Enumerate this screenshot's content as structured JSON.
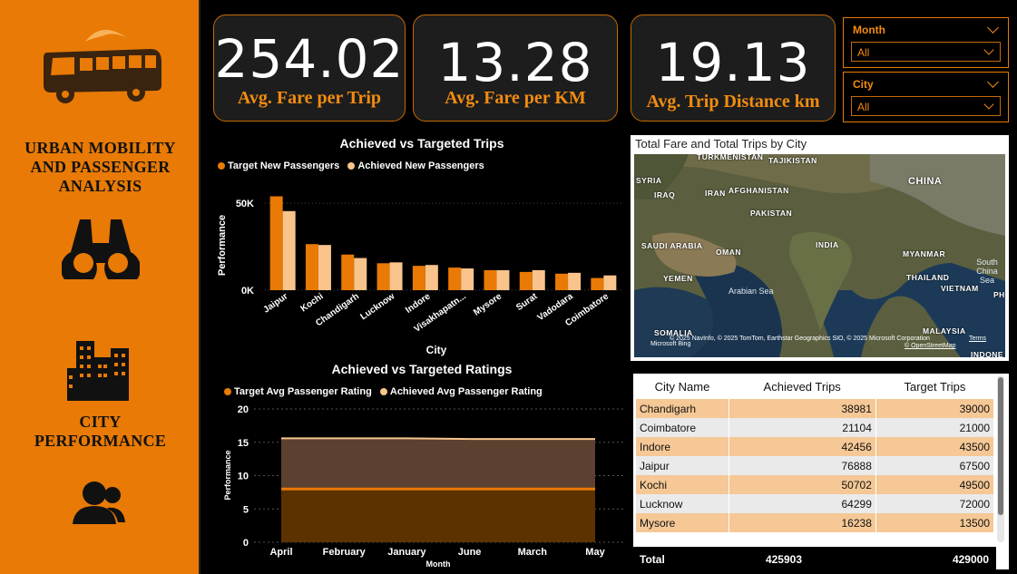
{
  "sidebar": {
    "title_line1": "URBAN MOBILITY",
    "title_line2": "AND PASSENGER",
    "title_line3": "ANALYSIS",
    "section_line1": "CITY",
    "section_line2": "PERFORMANCE",
    "icons": [
      "bus-icon",
      "binoculars-icon",
      "buildings-icon",
      "users-icon"
    ]
  },
  "kpis": [
    {
      "value": "254.02",
      "label": "Avg. Fare per Trip"
    },
    {
      "value": "13.28",
      "label": "Avg. Fare per KM"
    },
    {
      "value": "19.13",
      "label": "Avg. Trip Distance km"
    }
  ],
  "slicers": [
    {
      "title": "Month",
      "value": "All"
    },
    {
      "title": "City",
      "value": "All"
    }
  ],
  "colors": {
    "accent": "#e87a05",
    "light": "#f8c48c",
    "dark_fill": "#5c3200"
  },
  "trips_chart": {
    "title": "Achieved vs Targeted Trips",
    "legend": [
      "Target New Passengers",
      "Achieved New Passengers"
    ],
    "ylabel": "Performance",
    "xlabel": "City",
    "yticks": [
      "50K",
      "0K"
    ]
  },
  "ratings_chart": {
    "title": "Achieved vs Targeted Ratings",
    "legend": [
      "Target Avg Passenger Rating",
      "Achieved Avg Passenger Rating"
    ],
    "ylabel": "Performance",
    "xlabel": "Month",
    "yticks": [
      "20",
      "15",
      "10",
      "5",
      "0"
    ]
  },
  "chart_data": [
    {
      "type": "bar",
      "title": "Achieved vs Targeted Trips",
      "xlabel": "City",
      "ylabel": "Performance",
      "categories": [
        "Jaipur",
        "Kochi",
        "Chandigarh",
        "Lucknow",
        "Indore",
        "Visakhapatn...",
        "Mysore",
        "Surat",
        "Vadodara",
        "Coimbatore"
      ],
      "series": [
        {
          "name": "Target New Passengers",
          "values": [
            54000,
            26500,
            20500,
            15500,
            14000,
            13000,
            11500,
            10500,
            9500,
            7000
          ]
        },
        {
          "name": "Achieved New Passengers",
          "values": [
            45500,
            26000,
            18500,
            16000,
            14500,
            12500,
            11500,
            11500,
            10000,
            8500
          ]
        }
      ],
      "ylim": [
        0,
        60000
      ],
      "legend": "top"
    },
    {
      "type": "area",
      "title": "Achieved vs Targeted Ratings",
      "xlabel": "Month",
      "ylabel": "Performance",
      "categories": [
        "April",
        "February",
        "January",
        "June",
        "March",
        "May"
      ],
      "series": [
        {
          "name": "Target Avg Passenger Rating",
          "values": [
            8.0,
            8.0,
            8.0,
            8.0,
            8.0,
            8.0
          ]
        },
        {
          "name": "Achieved Avg Passenger Rating",
          "values": [
            15.6,
            15.6,
            15.6,
            15.5,
            15.5,
            15.5
          ]
        }
      ],
      "ylim": [
        0,
        20
      ],
      "legend": "top"
    }
  ],
  "map": {
    "title": "Total Fare and Total Trips by City",
    "labels": [
      "TURKMENISTAN",
      "TAJIKISTAN",
      "SYRIA",
      "IRAQ",
      "IRAN",
      "AFGHANISTAN",
      "CHINA",
      "PAKISTAN",
      "SAUDI ARABIA",
      "OMAN",
      "INDIA",
      "MYANMAR",
      "YEMEN",
      "THAILAND",
      "VIETNAM",
      "South China Sea",
      "PH",
      "Arabian Sea",
      "SOMALIA",
      "MALAYSIA",
      "INDONE"
    ],
    "copyright": "© 2025 NavInfo, © 2025 TomTom, Earthstar Geographics SIO, © 2025 Microsoft Corporation",
    "terms": "Terms",
    "osm": "© OpenStreetMap",
    "brand": "Microsoft Bing"
  },
  "table": {
    "headers": [
      "City Name",
      "Achieved Trips",
      "Target Trips"
    ],
    "rows": [
      [
        "Chandigarh",
        "38981",
        "39000"
      ],
      [
        "Coimbatore",
        "21104",
        "21000"
      ],
      [
        "Indore",
        "42456",
        "43500"
      ],
      [
        "Jaipur",
        "76888",
        "67500"
      ],
      [
        "Kochi",
        "50702",
        "49500"
      ],
      [
        "Lucknow",
        "64299",
        "72000"
      ],
      [
        "Mysore",
        "16238",
        "13500"
      ]
    ],
    "total": [
      "Total",
      "425903",
      "429000"
    ]
  }
}
